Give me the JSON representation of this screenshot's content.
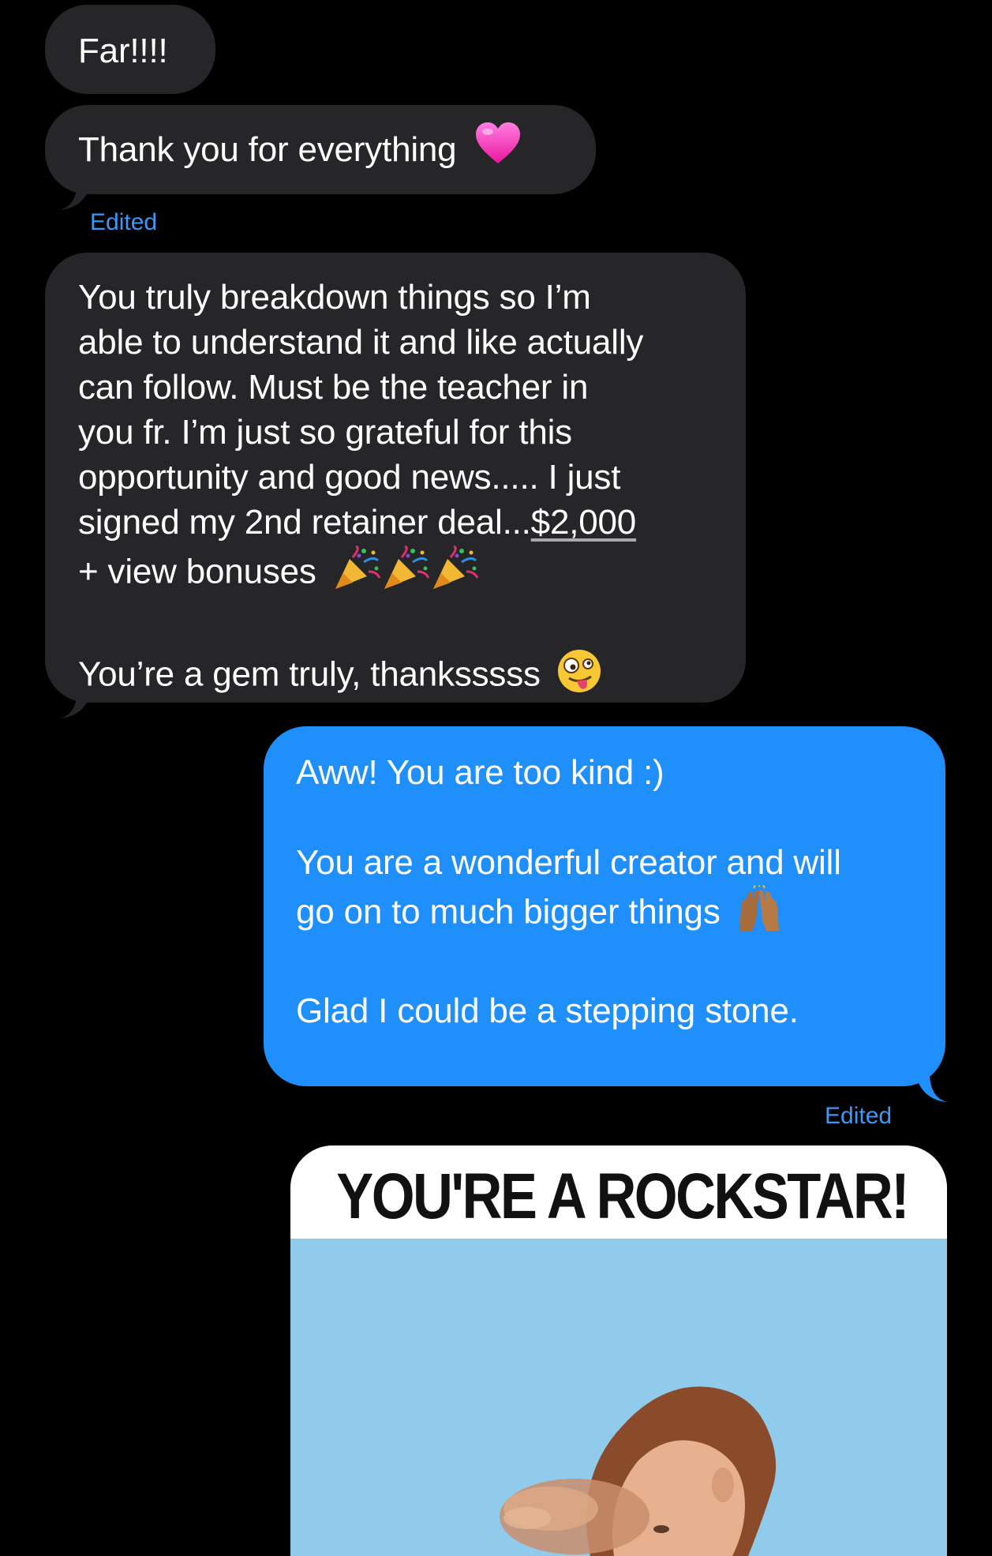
{
  "conversation": {
    "received_1": {
      "text": "Far!!!!"
    },
    "received_2": {
      "text": "Thank you for everything",
      "emoji": "pink-heart",
      "edited_label": "Edited"
    },
    "received_3": {
      "lines": [
        "You truly breakdown things so I’m",
        "able to understand it and like actually",
        "can follow. Must be the teacher in",
        "you fr. I’m just so grateful for this",
        "opportunity and good news..... I just",
        "signed my 2nd retainer deal..."
      ],
      "amount": "$2,000",
      "line_7": "+ view bonuses",
      "party_emojis": [
        "party-popper",
        "party-popper",
        "party-popper"
      ],
      "closing": "You’re a gem truly, thanksssss",
      "closing_emoji": "zany-face"
    },
    "sent_1": {
      "line_1": "Aww! You are too kind :)",
      "line_2": "You are a wonderful creator and will",
      "line_3": "go on to much bigger things",
      "line_3_emoji": "raising-hands",
      "line_4": "Glad I could be a stepping stone.",
      "edited_label": "Edited"
    },
    "image_message": {
      "caption": "YOU'RE A ROCKSTAR!",
      "subject": "person-pointing-gif"
    }
  },
  "colors": {
    "background": "#000000",
    "received_bubble": "#262629",
    "sent_bubble": "#1f8ffc",
    "edited_label": "#3d97f5",
    "image_sky": "#8ecbec"
  }
}
